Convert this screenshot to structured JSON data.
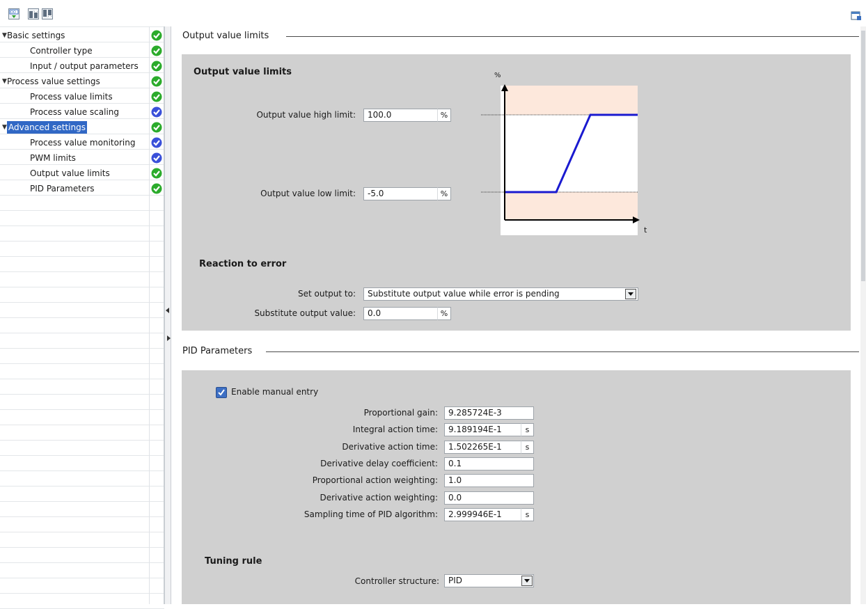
{
  "toolbar": {
    "icons": [
      "functional-view-icon",
      "move-up-icon",
      "move-down-icon"
    ],
    "right_icon": "window-layout-icon"
  },
  "nav": {
    "items": [
      {
        "label": "Basic settings",
        "level": 0,
        "expanded": true,
        "status": "ok"
      },
      {
        "label": "Controller type",
        "level": 1,
        "status": "ok"
      },
      {
        "label": "Input / output parameters",
        "level": 1,
        "status": "ok"
      },
      {
        "label": "Process value settings",
        "level": 0,
        "expanded": true,
        "status": "ok"
      },
      {
        "label": "Process value limits",
        "level": 1,
        "status": "ok"
      },
      {
        "label": "Process value scaling",
        "level": 1,
        "status": "default"
      },
      {
        "label": "Advanced settings",
        "level": 0,
        "expanded": true,
        "status": "ok",
        "selected": true
      },
      {
        "label": "Process value monitoring",
        "level": 1,
        "status": "default"
      },
      {
        "label": "PWM limits",
        "level": 1,
        "status": "default"
      },
      {
        "label": "Output value limits",
        "level": 1,
        "status": "ok"
      },
      {
        "label": "PID Parameters",
        "level": 1,
        "status": "ok"
      }
    ],
    "status_colors": {
      "ok": "#2bab2b",
      "default": "#3a50d9"
    }
  },
  "output_limits": {
    "section_title": "Output value limits",
    "panel_title": "Output value limits",
    "high_label": "Output value high limit:",
    "high_value": "100.0",
    "high_unit": "%",
    "low_label": "Output value low limit:",
    "low_value": "-5.0",
    "low_unit": "%",
    "chart": {
      "y_axis_label": "%",
      "x_axis_label": "t",
      "band_color": "#fde8dc",
      "line_color": "#1a1ad0"
    },
    "reaction_title": "Reaction to error",
    "set_output_label": "Set output to:",
    "set_output_value": "Substitute output value while error is pending",
    "substitute_label": "Substitute output value:",
    "substitute_value": "0.0",
    "substitute_unit": "%"
  },
  "pid": {
    "section_title": "PID Parameters",
    "enable_manual_label": "Enable manual entry",
    "enable_manual_checked": true,
    "fields": [
      {
        "label": "Proportional gain:",
        "value": "9.285724E-3",
        "unit": ""
      },
      {
        "label": "Integral action time:",
        "value": "9.189194E-1",
        "unit": "s"
      },
      {
        "label": "Derivative action time:",
        "value": "1.502265E-1",
        "unit": "s"
      },
      {
        "label": "Derivative delay coefficient:",
        "value": "0.1",
        "unit": ""
      },
      {
        "label": "Proportional action weighting:",
        "value": "1.0",
        "unit": ""
      },
      {
        "label": "Derivative action weighting:",
        "value": "0.0",
        "unit": ""
      },
      {
        "label": "Sampling time of PID algorithm:",
        "value": "2.999946E-1",
        "unit": "s"
      }
    ],
    "tuning_title": "Tuning rule",
    "structure_label": "Controller structure:",
    "structure_value": "PID"
  }
}
